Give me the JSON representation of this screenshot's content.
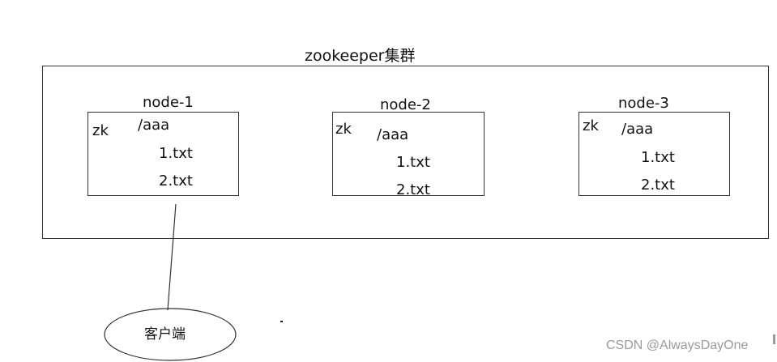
{
  "cluster": {
    "title": "zookeeper集群"
  },
  "nodes": [
    {
      "title": "node-1",
      "service": "zk",
      "path": "/aaa",
      "files": [
        "1.txt",
        "2.txt"
      ]
    },
    {
      "title": "node-2",
      "service": "zk",
      "path": "/aaa",
      "files": [
        "1.txt",
        "2.txt"
      ]
    },
    {
      "title": "node-3",
      "service": "zk",
      "path": "/aaa",
      "files": [
        "1.txt",
        "2.txt"
      ]
    }
  ],
  "client": {
    "label": "客户端"
  },
  "watermark": "CSDN @AlwaysDayOne"
}
